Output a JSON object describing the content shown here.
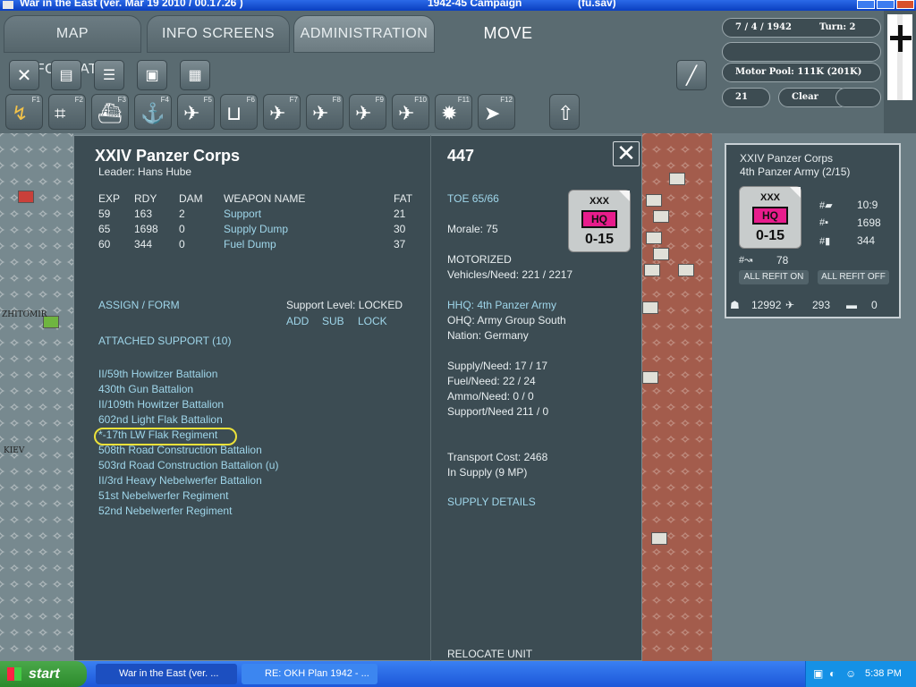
{
  "window": {
    "title": "War in the East (ver. Mar 19 2010 / 00.17.26 )",
    "campaign": "1942-45 Campaign",
    "save": "(fu.sav)"
  },
  "tabs": [
    {
      "label": "MAP INFORMATION"
    },
    {
      "label": "INFO SCREENS"
    },
    {
      "label": "ADMINISTRATION"
    },
    {
      "label": "MOVE"
    }
  ],
  "function_keys": [
    "F1",
    "F2",
    "F3",
    "F4",
    "F5",
    "F6",
    "F7",
    "F8",
    "F9",
    "F10",
    "F11",
    "F12"
  ],
  "status": {
    "date": "7 / 4 / 1942",
    "turn": "Turn: 2",
    "motor_pool": "Motor Pool:  111K  (201K)",
    "num": "21",
    "weather": "Clear"
  },
  "unit": {
    "name": "XXIV Panzer Corps",
    "leader": "Leader: Hans Hube",
    "id": "447",
    "table_headers": [
      "EXP",
      "RDY",
      "DAM",
      "WEAPON NAME",
      "FAT"
    ],
    "rows": [
      [
        "59",
        "163",
        "2",
        "Support",
        "21"
      ],
      [
        "65",
        "1698",
        "0",
        "Supply Dump",
        "30"
      ],
      [
        "60",
        "344",
        "0",
        "Fuel Dump",
        "37"
      ]
    ],
    "assign_form": "ASSIGN / FORM",
    "support_level": "Support Level: LOCKED",
    "add": "ADD",
    "sub": "SUB",
    "lock": "LOCK",
    "attached_support": "ATTACHED SUPPORT  (10)",
    "attached_units": [
      "II/59th Howitzer Battalion",
      "430th Gun Battalion",
      "II/109th Howitzer Battalion",
      "602nd Light Flak Battalion",
      "*-17th LW Flak Regiment",
      "508th Road Construction Battalion",
      "503rd Road Construction Battalion (u)",
      "II/3rd Heavy Nebelwerfer Battalion",
      "51st Nebelwerfer Regiment",
      "52nd Nebelwerfer Regiment"
    ],
    "toe": "TOE 65/66",
    "morale": "Morale:   75",
    "motorized": "MOTORIZED",
    "vehicles": "Vehicles/Need:   221 / 2217",
    "hhq": "HHQ: 4th Panzer Army",
    "ohq": "OHQ: Army Group South",
    "nation": "Nation:   Germany",
    "supply": "Supply/Need:   17 / 17",
    "fuel": "Fuel/Need:      22 / 24",
    "ammo": "Ammo/Need:    0 / 0",
    "support_need": "Support/Need    211 / 0",
    "transport_cost": "Transport Cost:      2468",
    "in_supply": "In Supply (9 MP)",
    "supply_details": "SUPPLY DETAILS",
    "relocate": "RELOCATE UNIT"
  },
  "counter": {
    "size": "XXX",
    "type": "HQ",
    "strength": "0-15"
  },
  "side_box": {
    "name": "XXIV Panzer Corps",
    "parent": "4th Panzer Army (2/15)",
    "tanks": "10:9",
    "guns": "1698",
    "ammo": "344",
    "moves": "78",
    "refit_on": "ALL REFIT ON",
    "refit_off": "ALL REFIT OFF",
    "men": "12992",
    "planes": "293",
    "afv": "0"
  },
  "map_labels": [
    "KIEV",
    "ZHITOMIR"
  ],
  "taskbar": {
    "start": "start",
    "item1": "War in the East (ver. ...",
    "item2": "RE: OKH Plan 1942 - ...",
    "time": "5:38 PM"
  },
  "colors": {
    "panel": "#3c4c53",
    "link": "#9fd6ea",
    "hq_pink": "#e81c8c",
    "highlight": "#ece23a"
  }
}
